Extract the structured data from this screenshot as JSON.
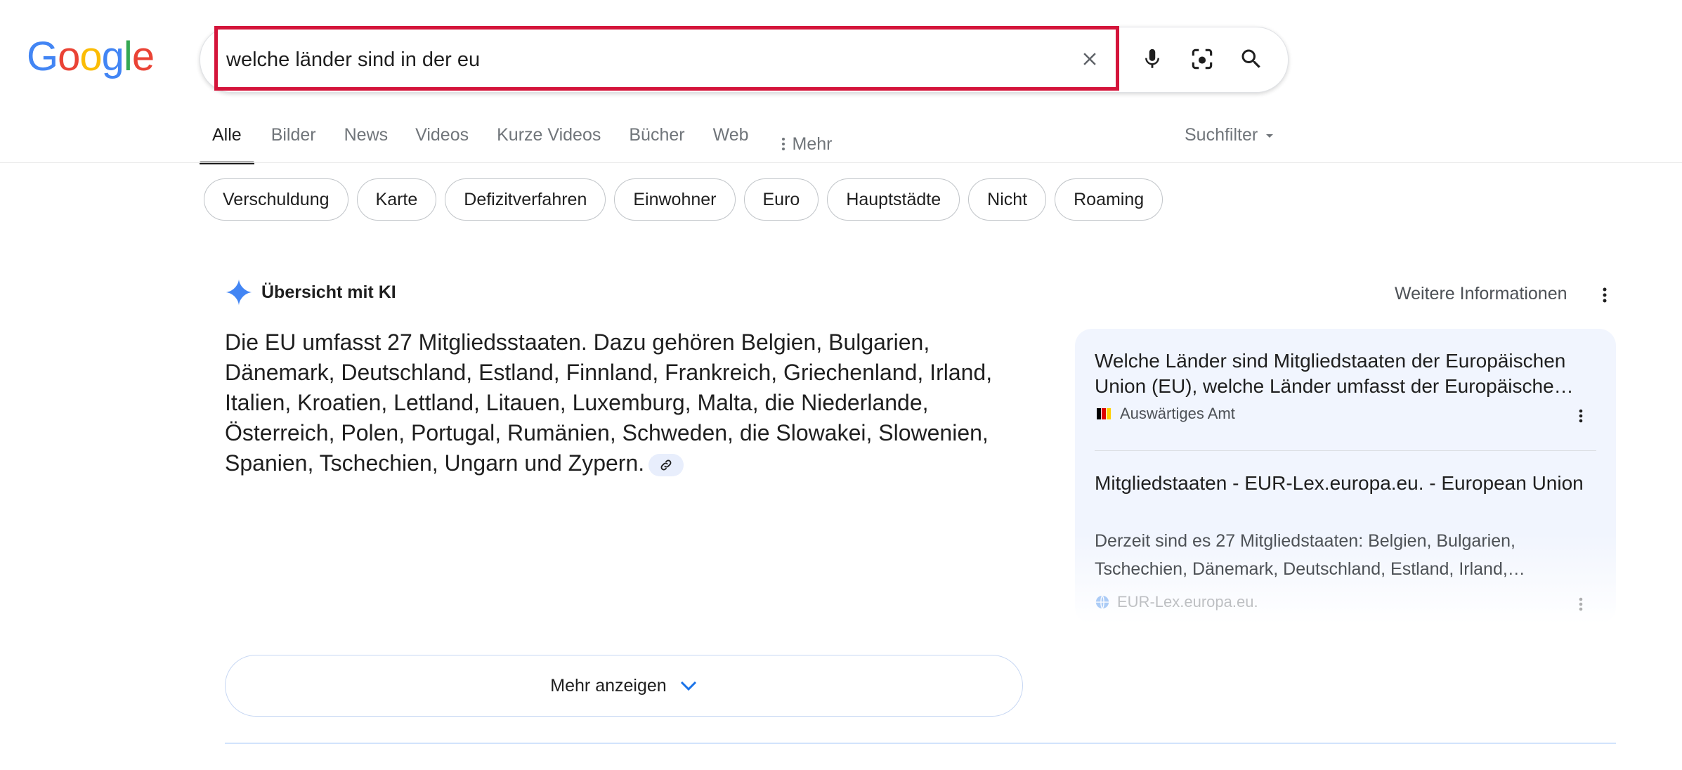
{
  "logo": {
    "letters": [
      "G",
      "o",
      "o",
      "g",
      "l",
      "e"
    ],
    "colors": [
      "#4285f4",
      "#ea4335",
      "#fbbc05",
      "#4285f4",
      "#34a853",
      "#ea4335"
    ]
  },
  "search": {
    "value": "welche länder sind in der eu",
    "placeholder": ""
  },
  "tabs": [
    {
      "label": "Alle",
      "active": true
    },
    {
      "label": "Bilder"
    },
    {
      "label": "News"
    },
    {
      "label": "Videos"
    },
    {
      "label": "Kurze Videos"
    },
    {
      "label": "Bücher"
    },
    {
      "label": "Web"
    },
    {
      "label": "Mehr"
    }
  ],
  "suchfilter": "Suchfilter",
  "chips": [
    "Verschuldung",
    "Karte",
    "Defizitverfahren",
    "Einwohner",
    "Euro",
    "Hauptstädte",
    "Nicht",
    "Roaming"
  ],
  "ai": {
    "title": "Übersicht mit KI",
    "more_info": "Weitere Informationen",
    "text": "Die EU umfasst 27 Mitgliedsstaaten. Dazu gehören Belgien, Bulgarien, Dänemark, Deutschland, Estland, Finnland, Frankreich, Griechenland, Irland, Italien, Kroatien, Lettland, Litauen, Luxemburg, Malta, die Niederlande, Österreich, Polen, Portugal, Rumänien, Schweden, die Slowakei, Slowenien, Spanien, Tschechien, Ungarn und Zypern."
  },
  "sources": [
    {
      "title": "Welche Länder sind Mitgliedstaaten der Europäischen Union (EU), welche Länder umfasst der Europäische…",
      "site": "Auswärtiges Amt"
    },
    {
      "title": "Mitgliedstaaten - EUR-Lex.europa.eu. - European Union",
      "snippet": "Derzeit sind es 27 Mitgliedstaaten: Belgien, Bulgarien, Tschechien, Dänemark, Deutschland, Estland, Irland,…",
      "site": "EUR-Lex.europa.eu."
    }
  ],
  "more_button": "Mehr anzeigen",
  "colors": {
    "highlight": "#d4143a",
    "accent": "#1a73e8"
  }
}
